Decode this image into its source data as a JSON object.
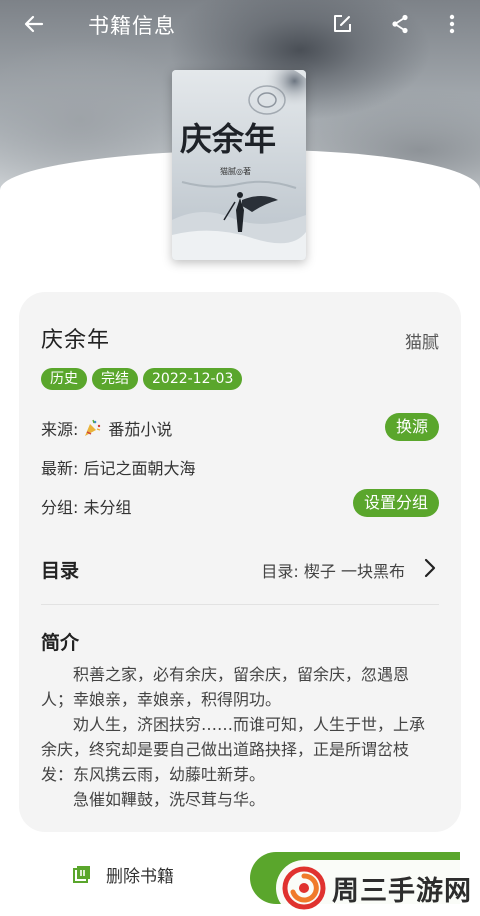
{
  "topbar": {
    "title": "书籍信息"
  },
  "cover": {
    "title_art": "庆余年",
    "author_mark": "猫腻◎著"
  },
  "book": {
    "title": "庆余年",
    "author": "猫腻",
    "tags": [
      "历史",
      "完结",
      "2022-12-03"
    ]
  },
  "source": {
    "label": "来源:",
    "name": "番茄小说",
    "button": "换源"
  },
  "latest": {
    "label": "最新: 后记之面朝大海"
  },
  "group": {
    "label": "分组: 未分组",
    "button": "设置分组"
  },
  "toc": {
    "title": "目录",
    "current": "目录: 楔子 一块黑布"
  },
  "intro": {
    "title": "简介",
    "paragraphs": [
      "积善之家，必有余庆，留余庆，留余庆，忽遇恩人；幸娘亲，幸娘亲，积得阴功。",
      "劝人生，济困扶穷……而谁可知，人生于世，上承余庆，终究却是要自己做出道路抉择，正是所谓岔枝发：东风携云雨，幼藤吐新芽。",
      "急催如鞸鼓，洗尽茸与华。"
    ]
  },
  "bottom": {
    "delete_label": "删除书籍"
  },
  "watermark": {
    "text": "周三手游网"
  },
  "colors": {
    "accent": "#5aa62c"
  }
}
